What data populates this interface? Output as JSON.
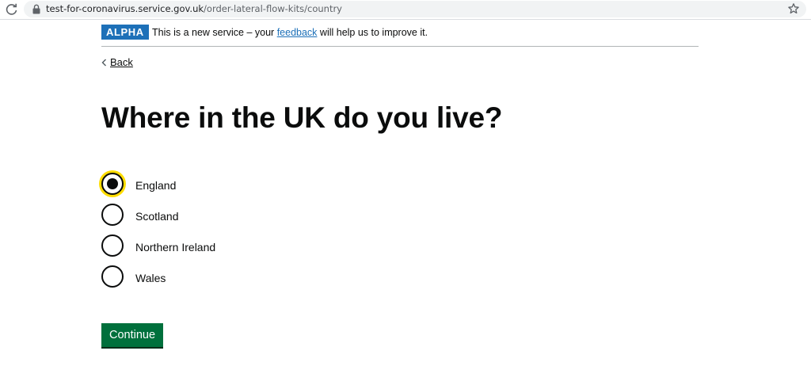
{
  "browser": {
    "url_host": "test-for-coronavirus.service.gov.uk",
    "url_path": "/order-lateral-flow-kits/country"
  },
  "phase_banner": {
    "tag": "ALPHA",
    "text_before": "This is a new service – your ",
    "link_text": "feedback",
    "text_after": " will help us to improve it."
  },
  "back_link": "Back",
  "question": "Where in the UK do you live?",
  "options": [
    {
      "label": "England",
      "selected": true
    },
    {
      "label": "Scotland",
      "selected": false
    },
    {
      "label": "Northern Ireland",
      "selected": false
    },
    {
      "label": "Wales",
      "selected": false
    }
  ],
  "continue_label": "Continue",
  "colors": {
    "tag_blue": "#1d70b8",
    "focus_yellow": "#ffdd00",
    "button_green": "#00703c"
  }
}
